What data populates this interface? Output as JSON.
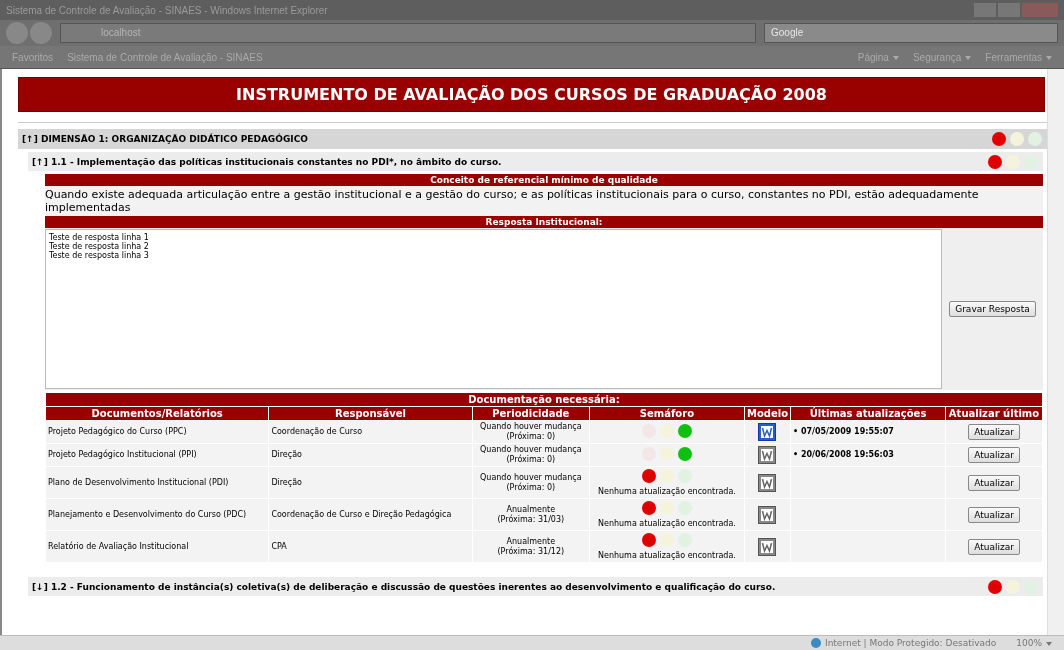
{
  "window": {
    "title": "Sistema de Controle de Avaliação - SINAES - Windows Internet Explorer",
    "address": "localhost",
    "search_placeholder": "Google"
  },
  "favorites_bar": {
    "favorites": "Favoritos",
    "tab": "Sistema de Controle de Avaliação - SINAES",
    "menus": [
      "Página",
      "Segurança",
      "Ferramentas"
    ]
  },
  "page": {
    "title": "INSTRUMENTO DE AVALIAÇÃO DOS CURSOS DE GRADUAÇÃO 2008",
    "dimension": {
      "toggle": "[↑]",
      "label": "DIMENSÃO 1: ORGANIZAÇÃO DIDÁTICO PEDAGÓGICO",
      "semaphore": {
        "red": true,
        "yellow": false,
        "green": false
      }
    },
    "indicators": [
      {
        "toggle": "[↑]",
        "label": "1.1 - Implementação das políticas institucionais constantes no PDI*, no âmbito do curso.",
        "semaphore": {
          "red": true,
          "yellow": false,
          "green": false
        },
        "concept_header": "Conceito de referencial mínimo de qualidade",
        "concept": "Quando existe adequada articulação entre a gestão institucional e a gestão do curso; e as políticas institucionais para o curso, constantes no PDI, estão adequadamente implementadas",
        "answer_header": "Resposta Institucional:",
        "answer": "Teste de resposta linha 1\nTeste de resposta linha 2\nTeste de resposta linha 3",
        "save_button": "Gravar Resposta",
        "docs_header": "Documentação necessária:",
        "columns": [
          "Documentos/Relatórios",
          "Responsável",
          "Periodicidade",
          "Semáforo",
          "Modelo",
          "Últimas atualizações",
          "Atualizar último"
        ],
        "rows": [
          {
            "document": "Projeto Pedagógico do Curso (PPC)",
            "responsible": "Coordenação de Curso",
            "periodicity": "Quando houver mudança",
            "next": "(Próxima: 0)",
            "semaphore": {
              "red": false,
              "yellow": false,
              "green": true
            },
            "model_available": true,
            "last_update": "• 07/05/2009 19:55:07",
            "button": "Atualizar"
          },
          {
            "document": "Projeto Pedagógico Institucional (PPI)",
            "responsible": "Direção",
            "periodicity": "Quando houver mudança",
            "next": "(Próxima: 0)",
            "semaphore": {
              "red": false,
              "yellow": false,
              "green": true
            },
            "model_available": false,
            "last_update": "• 20/06/2008 19:56:03",
            "button": "Atualizar"
          },
          {
            "document": "Plano de Desenvolvimento Institucional (PDI)",
            "responsible": "Direção",
            "periodicity": "Quando houver mudança",
            "next": "(Próxima: 0)",
            "semaphore": {
              "red": true,
              "yellow": false,
              "green": false
            },
            "note": "Nenhuma atualização encontrada.",
            "model_available": false,
            "button": "Atualizar"
          },
          {
            "document": "Planejamento e Desenvolvimento do Curso (PDC)",
            "responsible": "Coordenação de Curso e Direção Pedagógica",
            "periodicity": "Anualmente",
            "next": "(Próxima: 31/03)",
            "semaphore": {
              "red": true,
              "yellow": false,
              "green": false
            },
            "note": "Nenhuma atualização encontrada.",
            "model_available": false,
            "button": "Atualizar"
          },
          {
            "document": "Relatório de Avaliação Institucional",
            "responsible": "CPA",
            "periodicity": "Anualmente",
            "next": "(Próxima: 31/12)",
            "semaphore": {
              "red": true,
              "yellow": false,
              "green": false
            },
            "note": "Nenhuma atualização encontrada.",
            "model_available": false,
            "button": "Atualizar"
          }
        ]
      },
      {
        "toggle": "[↓]",
        "label": "1.2 - Funcionamento de instância(s) coletiva(s) de deliberação e discussão de questões inerentes ao desenvolvimento e qualificação do curso.",
        "semaphore": {
          "red": true,
          "yellow": false,
          "green": false
        }
      }
    ]
  },
  "status_bar": {
    "zone": "Internet | Modo Protegido: Desativado",
    "zoom": "100%"
  }
}
